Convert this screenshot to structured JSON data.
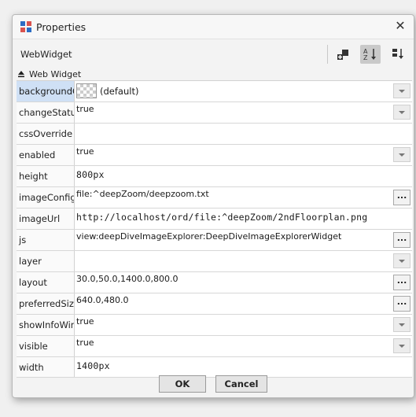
{
  "window": {
    "title": "Properties",
    "close_glyph": "✕"
  },
  "toolbar": {
    "object_name": "WebWidget",
    "icons": [
      "add-slot-icon",
      "sort-alpha-icon",
      "sort-order-icon"
    ]
  },
  "section": {
    "label": "Web Widget"
  },
  "properties": [
    {
      "name": "backgroundCo",
      "value": "(default)",
      "editor": "color",
      "selected": true
    },
    {
      "name": "changeStatus(",
      "value": "true",
      "editor": "dropdown"
    },
    {
      "name": "cssOverride",
      "value": "",
      "editor": "text"
    },
    {
      "name": "enabled",
      "value": "true",
      "editor": "dropdown"
    },
    {
      "name": "height",
      "value": "800px",
      "editor": "mono"
    },
    {
      "name": "imageConfigF",
      "value": "file:^deepZoom/deepzoom.txt",
      "editor": "browse"
    },
    {
      "name": "imageUrl",
      "value": "http://localhost/ord/file:^deepZoom/2ndFloorplan.png",
      "editor": "mono"
    },
    {
      "name": "js",
      "value": "view:deepDiveImageExplorer:DeepDiveImageExplorerWidget",
      "editor": "browse"
    },
    {
      "name": "layer",
      "value": "",
      "editor": "dropdown"
    },
    {
      "name": "layout",
      "value": "30.0,50.0,1400.0,800.0",
      "editor": "browse"
    },
    {
      "name": "preferredSize",
      "value": "640.0,480.0",
      "editor": "browse"
    },
    {
      "name": "showInfoWinc",
      "value": "true",
      "editor": "dropdown"
    },
    {
      "name": "visible",
      "value": "true",
      "editor": "dropdown"
    },
    {
      "name": "width",
      "value": "1400px",
      "editor": "mono"
    }
  ],
  "buttons": {
    "ok": "OK",
    "cancel": "Cancel",
    "browse": "..."
  },
  "colors": {
    "selected_row": "#cfe0f5",
    "grid_line": "#d7d7d7"
  }
}
